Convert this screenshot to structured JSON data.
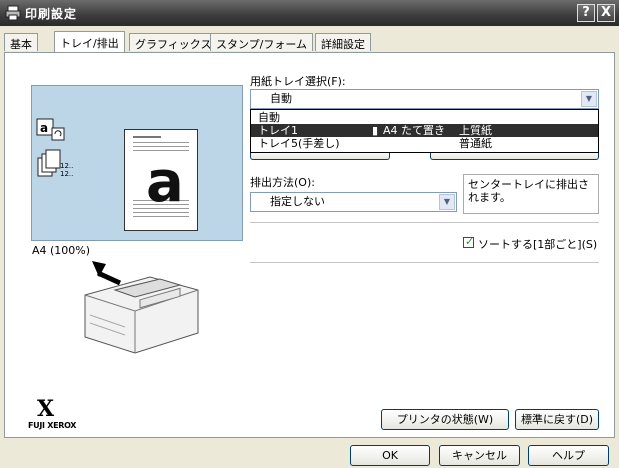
{
  "window": {
    "title": "印刷設定",
    "help_button": "?",
    "close_button": "X"
  },
  "tabs": [
    {
      "label": "基本"
    },
    {
      "label": "トレイ/排出"
    },
    {
      "label": "グラフィックス"
    },
    {
      "label": "スタンプ/フォーム"
    },
    {
      "label": "詳細設定"
    }
  ],
  "preview": {
    "big_letter": "a",
    "small_icon_letter": "a",
    "size_label": "A4 (100%)",
    "stack_text": "12.."
  },
  "paper_tray": {
    "label": "用紙トレイ選択(F):",
    "selected": "自動",
    "options": [
      {
        "name": "自動",
        "size": "",
        "type": ""
      },
      {
        "name": "トレイ1",
        "size": "A4 たて置き",
        "type": "上質紙"
      },
      {
        "name": "トレイ5(手差し)",
        "size": "",
        "type": "普通紙"
      }
    ]
  },
  "output": {
    "label": "排出方法(O):",
    "selected": "指定しない",
    "info": "センタートレイに排出されます。",
    "collate_label": "ソートする[1部ごと](S)",
    "collate_checked": true
  },
  "buttons": {
    "printer_status": "プリンタの状態(W)",
    "restore_defaults": "標準に戻す(D)",
    "ok": "OK",
    "cancel": "キャンセル",
    "help": "ヘルプ"
  },
  "brand": {
    "logo_letter": "X",
    "logo_text": "FUJI XEROX"
  },
  "colors": {
    "preview_bg": "#bcd6e8",
    "selected_row": "#2e2e2e",
    "titlebar": "#3c3c3c"
  }
}
